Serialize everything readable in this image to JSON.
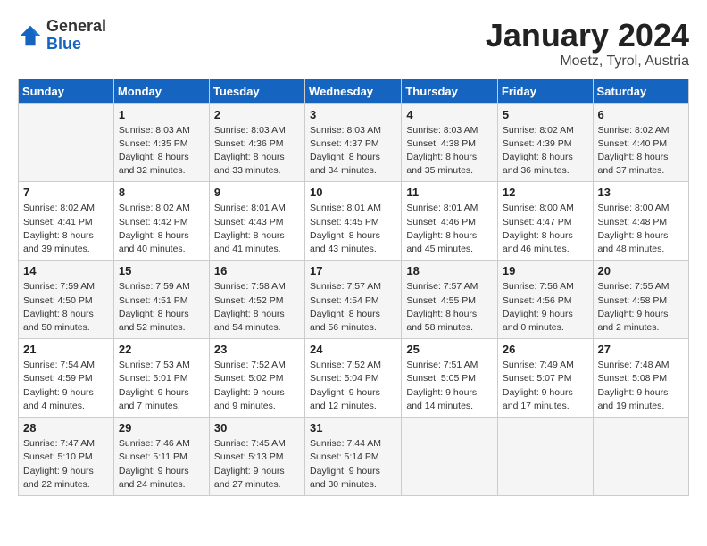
{
  "header": {
    "logo_general": "General",
    "logo_blue": "Blue",
    "month_title": "January 2024",
    "location": "Moetz, Tyrol, Austria"
  },
  "days_of_week": [
    "Sunday",
    "Monday",
    "Tuesday",
    "Wednesday",
    "Thursday",
    "Friday",
    "Saturday"
  ],
  "weeks": [
    [
      {
        "day": "",
        "sunrise": "",
        "sunset": "",
        "daylight": ""
      },
      {
        "day": "1",
        "sunrise": "Sunrise: 8:03 AM",
        "sunset": "Sunset: 4:35 PM",
        "daylight": "Daylight: 8 hours and 32 minutes."
      },
      {
        "day": "2",
        "sunrise": "Sunrise: 8:03 AM",
        "sunset": "Sunset: 4:36 PM",
        "daylight": "Daylight: 8 hours and 33 minutes."
      },
      {
        "day": "3",
        "sunrise": "Sunrise: 8:03 AM",
        "sunset": "Sunset: 4:37 PM",
        "daylight": "Daylight: 8 hours and 34 minutes."
      },
      {
        "day": "4",
        "sunrise": "Sunrise: 8:03 AM",
        "sunset": "Sunset: 4:38 PM",
        "daylight": "Daylight: 8 hours and 35 minutes."
      },
      {
        "day": "5",
        "sunrise": "Sunrise: 8:02 AM",
        "sunset": "Sunset: 4:39 PM",
        "daylight": "Daylight: 8 hours and 36 minutes."
      },
      {
        "day": "6",
        "sunrise": "Sunrise: 8:02 AM",
        "sunset": "Sunset: 4:40 PM",
        "daylight": "Daylight: 8 hours and 37 minutes."
      }
    ],
    [
      {
        "day": "7",
        "sunrise": "Sunrise: 8:02 AM",
        "sunset": "Sunset: 4:41 PM",
        "daylight": "Daylight: 8 hours and 39 minutes."
      },
      {
        "day": "8",
        "sunrise": "Sunrise: 8:02 AM",
        "sunset": "Sunset: 4:42 PM",
        "daylight": "Daylight: 8 hours and 40 minutes."
      },
      {
        "day": "9",
        "sunrise": "Sunrise: 8:01 AM",
        "sunset": "Sunset: 4:43 PM",
        "daylight": "Daylight: 8 hours and 41 minutes."
      },
      {
        "day": "10",
        "sunrise": "Sunrise: 8:01 AM",
        "sunset": "Sunset: 4:45 PM",
        "daylight": "Daylight: 8 hours and 43 minutes."
      },
      {
        "day": "11",
        "sunrise": "Sunrise: 8:01 AM",
        "sunset": "Sunset: 4:46 PM",
        "daylight": "Daylight: 8 hours and 45 minutes."
      },
      {
        "day": "12",
        "sunrise": "Sunrise: 8:00 AM",
        "sunset": "Sunset: 4:47 PM",
        "daylight": "Daylight: 8 hours and 46 minutes."
      },
      {
        "day": "13",
        "sunrise": "Sunrise: 8:00 AM",
        "sunset": "Sunset: 4:48 PM",
        "daylight": "Daylight: 8 hours and 48 minutes."
      }
    ],
    [
      {
        "day": "14",
        "sunrise": "Sunrise: 7:59 AM",
        "sunset": "Sunset: 4:50 PM",
        "daylight": "Daylight: 8 hours and 50 minutes."
      },
      {
        "day": "15",
        "sunrise": "Sunrise: 7:59 AM",
        "sunset": "Sunset: 4:51 PM",
        "daylight": "Daylight: 8 hours and 52 minutes."
      },
      {
        "day": "16",
        "sunrise": "Sunrise: 7:58 AM",
        "sunset": "Sunset: 4:52 PM",
        "daylight": "Daylight: 8 hours and 54 minutes."
      },
      {
        "day": "17",
        "sunrise": "Sunrise: 7:57 AM",
        "sunset": "Sunset: 4:54 PM",
        "daylight": "Daylight: 8 hours and 56 minutes."
      },
      {
        "day": "18",
        "sunrise": "Sunrise: 7:57 AM",
        "sunset": "Sunset: 4:55 PM",
        "daylight": "Daylight: 8 hours and 58 minutes."
      },
      {
        "day": "19",
        "sunrise": "Sunrise: 7:56 AM",
        "sunset": "Sunset: 4:56 PM",
        "daylight": "Daylight: 9 hours and 0 minutes."
      },
      {
        "day": "20",
        "sunrise": "Sunrise: 7:55 AM",
        "sunset": "Sunset: 4:58 PM",
        "daylight": "Daylight: 9 hours and 2 minutes."
      }
    ],
    [
      {
        "day": "21",
        "sunrise": "Sunrise: 7:54 AM",
        "sunset": "Sunset: 4:59 PM",
        "daylight": "Daylight: 9 hours and 4 minutes."
      },
      {
        "day": "22",
        "sunrise": "Sunrise: 7:53 AM",
        "sunset": "Sunset: 5:01 PM",
        "daylight": "Daylight: 9 hours and 7 minutes."
      },
      {
        "day": "23",
        "sunrise": "Sunrise: 7:52 AM",
        "sunset": "Sunset: 5:02 PM",
        "daylight": "Daylight: 9 hours and 9 minutes."
      },
      {
        "day": "24",
        "sunrise": "Sunrise: 7:52 AM",
        "sunset": "Sunset: 5:04 PM",
        "daylight": "Daylight: 9 hours and 12 minutes."
      },
      {
        "day": "25",
        "sunrise": "Sunrise: 7:51 AM",
        "sunset": "Sunset: 5:05 PM",
        "daylight": "Daylight: 9 hours and 14 minutes."
      },
      {
        "day": "26",
        "sunrise": "Sunrise: 7:49 AM",
        "sunset": "Sunset: 5:07 PM",
        "daylight": "Daylight: 9 hours and 17 minutes."
      },
      {
        "day": "27",
        "sunrise": "Sunrise: 7:48 AM",
        "sunset": "Sunset: 5:08 PM",
        "daylight": "Daylight: 9 hours and 19 minutes."
      }
    ],
    [
      {
        "day": "28",
        "sunrise": "Sunrise: 7:47 AM",
        "sunset": "Sunset: 5:10 PM",
        "daylight": "Daylight: 9 hours and 22 minutes."
      },
      {
        "day": "29",
        "sunrise": "Sunrise: 7:46 AM",
        "sunset": "Sunset: 5:11 PM",
        "daylight": "Daylight: 9 hours and 24 minutes."
      },
      {
        "day": "30",
        "sunrise": "Sunrise: 7:45 AM",
        "sunset": "Sunset: 5:13 PM",
        "daylight": "Daylight: 9 hours and 27 minutes."
      },
      {
        "day": "31",
        "sunrise": "Sunrise: 7:44 AM",
        "sunset": "Sunset: 5:14 PM",
        "daylight": "Daylight: 9 hours and 30 minutes."
      },
      {
        "day": "",
        "sunrise": "",
        "sunset": "",
        "daylight": ""
      },
      {
        "day": "",
        "sunrise": "",
        "sunset": "",
        "daylight": ""
      },
      {
        "day": "",
        "sunrise": "",
        "sunset": "",
        "daylight": ""
      }
    ]
  ]
}
